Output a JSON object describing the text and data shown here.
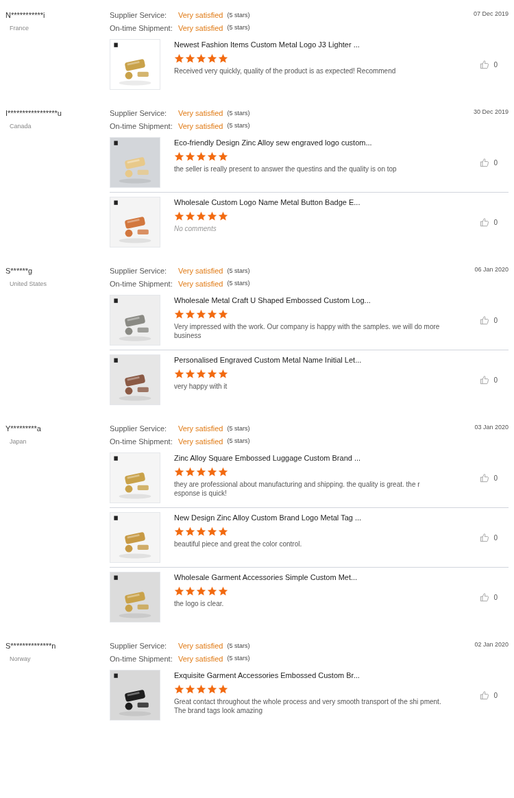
{
  "reviews": [
    {
      "name": "N***********i",
      "country": "France",
      "date": "07 Dec 2019",
      "ratings": [
        {
          "label": "Supplier Service:",
          "value": "Very satisfied",
          "stars_text": "(5 stars)"
        },
        {
          "label": "On-time Shipment:",
          "value": "Very satisfied",
          "stars_text": "(5 stars)"
        }
      ],
      "products": [
        {
          "title": "Newest Fashion Items Custom Metal Logo J3 Lighter ...",
          "stars": 5,
          "comment": "Received very quickly, quality of the product is as expected! Recommend",
          "empty": false,
          "likes": "0"
        }
      ]
    },
    {
      "name": "I*****************u",
      "country": "Canada",
      "date": "30 Dec 2019",
      "ratings": [
        {
          "label": "Supplier Service:",
          "value": "Very satisfied",
          "stars_text": "(5 stars)"
        },
        {
          "label": "On-time Shipment:",
          "value": "Very satisfied",
          "stars_text": "(5 stars)"
        }
      ],
      "products": [
        {
          "title": "Eco-friendly Design Zinc Alloy  sew engraved logo custom...",
          "stars": 5,
          "comment": "the seller is really present to answer the questins and the quality is on top",
          "empty": false,
          "likes": "0"
        },
        {
          "title": "Wholesale Custom Logo Name Metal Button Badge E...",
          "stars": 5,
          "comment": "No comments",
          "empty": true,
          "likes": "0"
        }
      ]
    },
    {
      "name": "S******g",
      "country": "United States",
      "date": "06 Jan 2020",
      "ratings": [
        {
          "label": "Supplier Service:",
          "value": "Very satisfied",
          "stars_text": "(5 stars)"
        },
        {
          "label": "On-time Shipment:",
          "value": "Very satisfied",
          "stars_text": "(5 stars)"
        }
      ],
      "products": [
        {
          "title": "Wholesale Metal Craft U Shaped Embossed Custom Log...",
          "stars": 5,
          "comment": "Very impressed with the work. Our company is happy with the samples. we will do more business",
          "empty": false,
          "likes": "0"
        },
        {
          "title": "Personalised Engraved Custom Metal Name Initial Let...",
          "stars": 5,
          "comment": "very happy with it",
          "empty": false,
          "likes": "0"
        }
      ]
    },
    {
      "name": "Y*********a",
      "country": "Japan",
      "date": "03 Jan 2020",
      "ratings": [
        {
          "label": "Supplier Service:",
          "value": "Very satisfied",
          "stars_text": "(5 stars)"
        },
        {
          "label": "On-time Shipment:",
          "value": "Very satisfied",
          "stars_text": "(5 stars)"
        }
      ],
      "products": [
        {
          "title": "Zinc Alloy Square Embossed Luggage Custom Brand ...",
          "stars": 5,
          "comment": "they are professional about manufacturing and shipping. the quality is great. the r esponse is quick!",
          "empty": false,
          "likes": "0"
        },
        {
          "title": "New Design Zinc Alloy Custom Brand Logo Metal Tag ...",
          "stars": 5,
          "comment": "beautiful piece and great the color control.",
          "empty": false,
          "likes": "0"
        },
        {
          "title": "Wholesale Garment Accessories Simple Custom Met...",
          "stars": 5,
          "comment": "the logo is clear.",
          "empty": false,
          "likes": "0"
        }
      ]
    },
    {
      "name": "S**************n",
      "country": "Norway",
      "date": "02 Jan 2020",
      "ratings": [
        {
          "label": "Supplier Service:",
          "value": "Very satisfied",
          "stars_text": "(5 stars)"
        },
        {
          "label": "On-time Shipment:",
          "value": "Very satisfied",
          "stars_text": "(5 stars)"
        }
      ],
      "products": [
        {
          "title": "Exquisite Garment Accessories Embossed Custom Br...",
          "stars": 5,
          "comment": "Great contact throughout the whole process and very smooth transport of the shi pment. The brand tags look amazing",
          "empty": false,
          "likes": "0"
        }
      ]
    }
  ]
}
